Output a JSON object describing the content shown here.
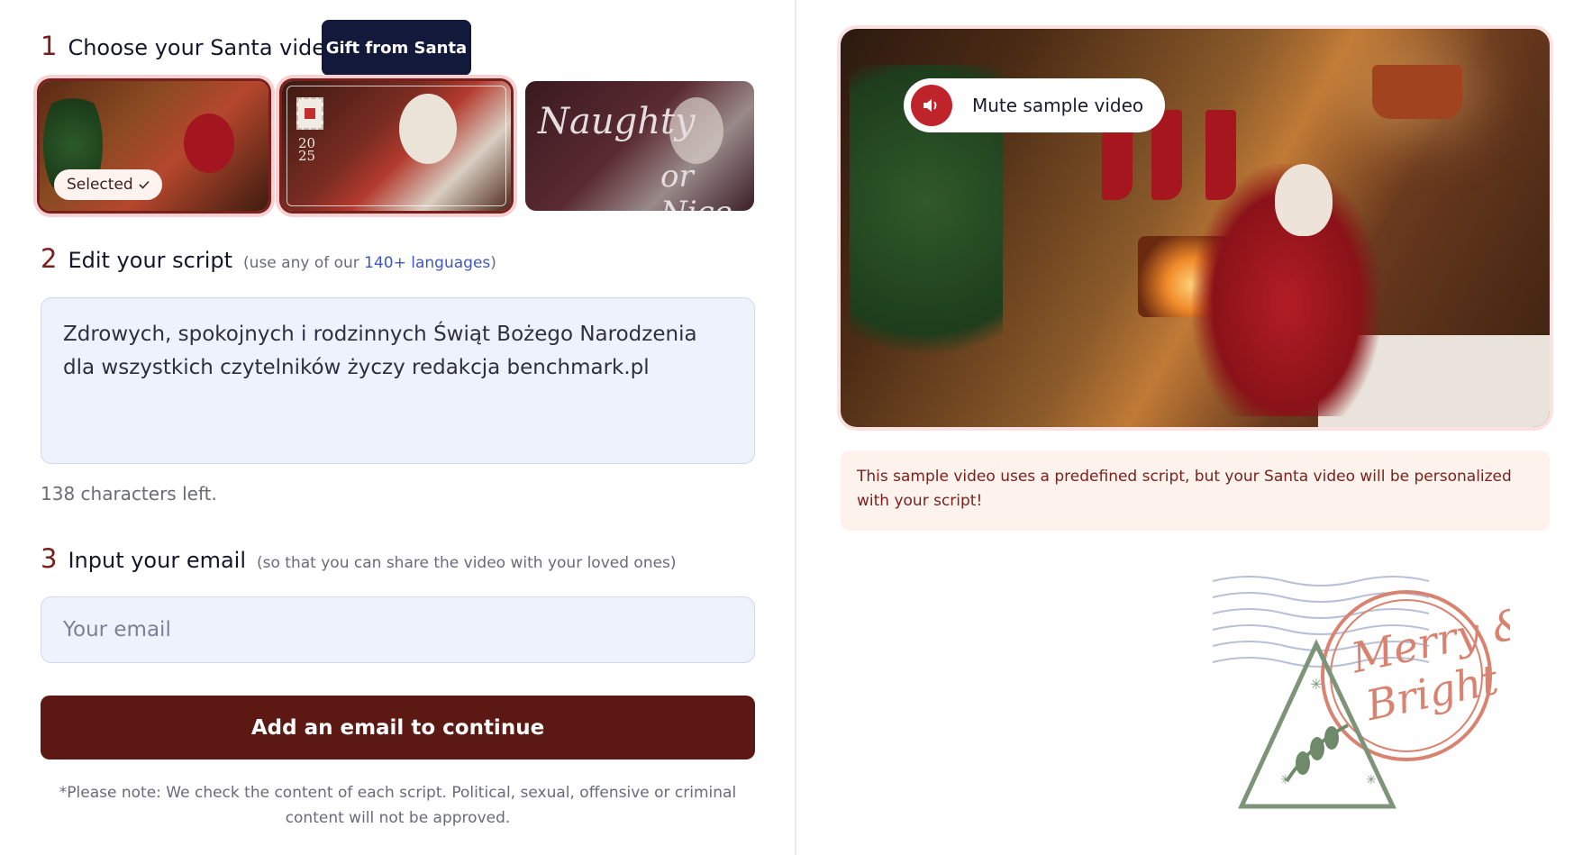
{
  "steps": {
    "step1": {
      "number": "1",
      "title": "Choose your Santa video"
    },
    "step2": {
      "number": "2",
      "title": "Edit your script",
      "hint_prefix": "(use any of our ",
      "hint_link": "140+ languages",
      "hint_suffix": ")"
    },
    "step3": {
      "number": "3",
      "title": "Input your email",
      "hint": "(so that you can share the video with your loved ones)"
    }
  },
  "tooltip": "Gift from Santa",
  "thumbnails": [
    {
      "chip": "Selected",
      "selected": true
    },
    {
      "year": "20\n25",
      "selected": true
    },
    {
      "overlay_line1": "Naughty",
      "overlay_line2": "or Nice",
      "selected": false
    }
  ],
  "script": {
    "text": "Zdrowych, spokojnych i rodzinnych Świąt Bożego Narodzenia dla wszystkich czytelników życzy redakcja benchmark.pl",
    "chars_left": "138 characters left."
  },
  "email": {
    "placeholder": "Your email",
    "value": ""
  },
  "cta_label": "Add an email to continue",
  "note": "*Please note: We check the content of each script. Political, sexual, offensive or criminal content will not be approved.",
  "video": {
    "mute_label": "Mute sample video"
  },
  "info": "This sample video uses a predefined script, but your Santa video will be personalized with your script!",
  "stamp": {
    "text_line1": "Merry &",
    "text_line2": "Bright"
  },
  "colors": {
    "brand": "#5c1813",
    "accent": "#7a1f1c",
    "link": "#3d57c5",
    "input_bg": "#eef2fd",
    "info_bg": "#fdf2ec",
    "mute_red": "#c0242b"
  }
}
